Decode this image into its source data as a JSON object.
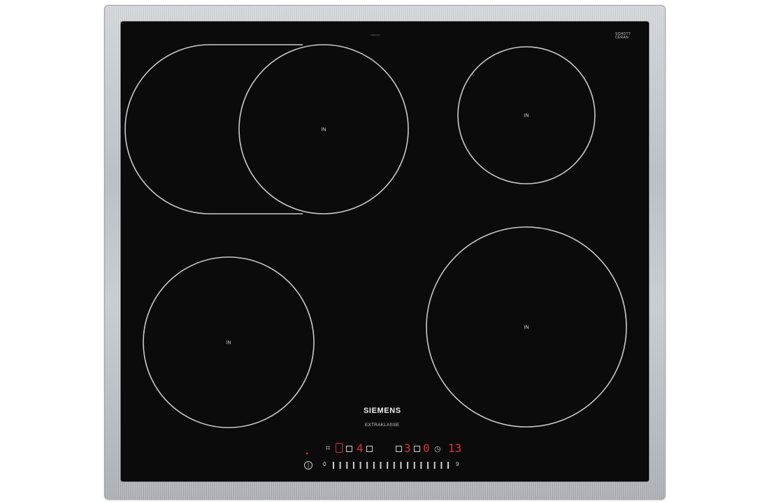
{
  "brand": {
    "logo": "SIEMENS",
    "series": "EXTRAKLASSE",
    "glass_maker_line1": "SCHOTT",
    "glass_maker_line2": "CERAN",
    "tiny_top_mark": "induction"
  },
  "zones": [
    {
      "id": "front-left-flex",
      "label": "IN"
    },
    {
      "id": "rear-right",
      "label": "IN"
    },
    {
      "id": "front-left",
      "label": "IN"
    },
    {
      "id": "front-right",
      "label": "IN"
    }
  ],
  "control_panel": {
    "display_left": "4",
    "display_mid": "3",
    "display_mid2": "0",
    "display_timer": "13",
    "slider_start": "0",
    "slider_end": "9",
    "tick_count": 18,
    "colors": {
      "led": "#d8322b",
      "glass": "#0b0b0b",
      "ring": "#c9c9c9"
    },
    "icons": [
      "power-icon",
      "pan-icon",
      "zone-select-icon",
      "timer-icon",
      "sprint-icon"
    ]
  }
}
